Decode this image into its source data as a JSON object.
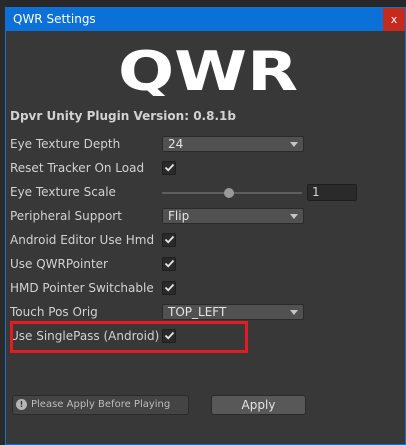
{
  "window": {
    "title": "QWR Settings",
    "close_label": "x",
    "logo_text": "QWR"
  },
  "version": "Dpvr Unity Plugin Version: 0.8.1b",
  "settings": [
    {
      "label": "Eye Texture Depth",
      "control": "dropdown",
      "value": "24"
    },
    {
      "label": "Reset Tracker On Load",
      "control": "checkbox",
      "checked": true
    },
    {
      "label": "Eye Texture Scale",
      "control": "slider",
      "value": "1"
    },
    {
      "label": "Peripheral Support",
      "control": "dropdown",
      "value": "Flip"
    },
    {
      "label": "Android Editor Use Hmd",
      "control": "checkbox",
      "checked": true
    },
    {
      "label": "Use QWRPointer",
      "control": "checkbox",
      "checked": true
    },
    {
      "label": "HMD Pointer Switchable",
      "control": "checkbox",
      "checked": true
    },
    {
      "label": "Touch Pos Orig",
      "control": "dropdown",
      "value": "TOP_LEFT"
    },
    {
      "label": "Use SinglePass (Android)",
      "control": "checkbox",
      "checked": true
    }
  ],
  "help": {
    "icon": "info-icon",
    "text": "Please Apply Before Playing"
  },
  "apply_label": "Apply",
  "colors": {
    "titlebar": "#0b70d8",
    "close": "#c42b1c",
    "highlight": "#e31b23",
    "panel": "#383838"
  }
}
